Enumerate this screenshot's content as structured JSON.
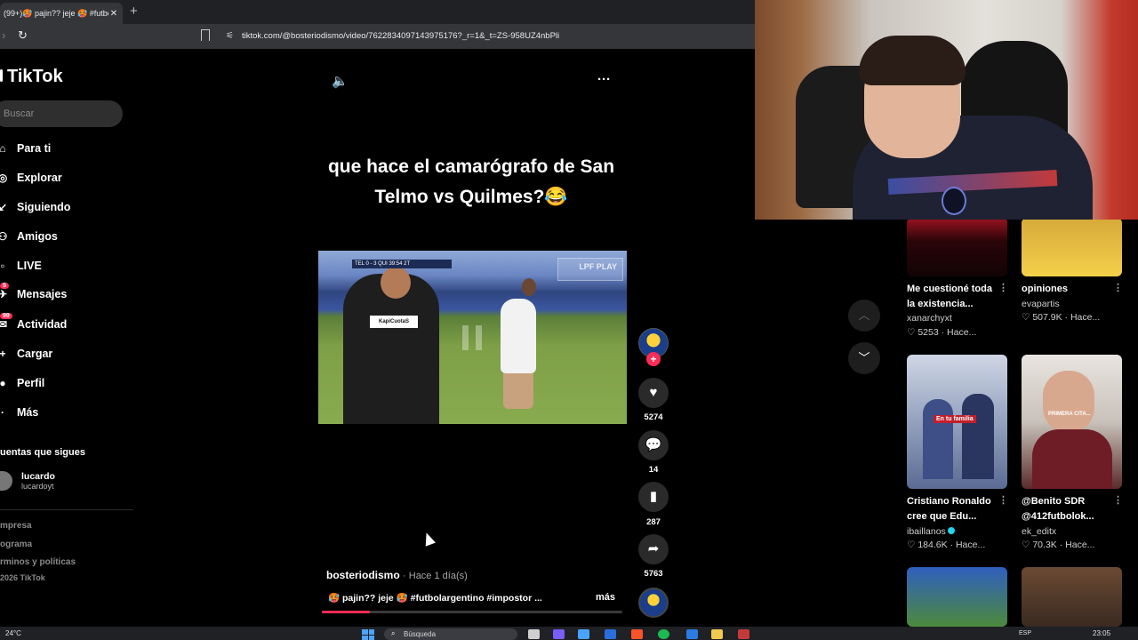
{
  "browser": {
    "tab_title": "(99+)🥵 pajin?? jeje 🥵 #futbo",
    "tab_close": "✕",
    "new_tab": "+",
    "url": "tiktok.com/@bosteriodismo/video/7622834097143975176?_r=1&_t=ZS-958UZ4nbPli",
    "icons": {
      "forward": "chevron-right-icon",
      "reload": "reload-icon",
      "bookmark": "bookmark-icon",
      "site_settings": "tune-icon"
    }
  },
  "sidebar": {
    "logo": "TikTok",
    "search_placeholder": "Buscar",
    "items": [
      {
        "label": "Para ti",
        "icon": "home-icon"
      },
      {
        "label": "Explorar",
        "icon": "compass-icon"
      },
      {
        "label": "Siguiendo",
        "icon": "following-icon"
      },
      {
        "label": "Amigos",
        "icon": "friends-icon"
      },
      {
        "label": "LIVE",
        "icon": "live-icon"
      },
      {
        "label": "Mensajes",
        "icon": "messages-icon",
        "badge": "5"
      },
      {
        "label": "Actividad",
        "icon": "activity-icon",
        "badge": "99"
      },
      {
        "label": "Cargar",
        "icon": "upload-icon"
      },
      {
        "label": "Perfil",
        "icon": "profile-icon"
      },
      {
        "label": "Más",
        "icon": "more-icon"
      }
    ],
    "following_title": "uentas que sigues",
    "followed_account": {
      "name": "lucardo",
      "handle": "lucardoyt"
    },
    "footer": [
      "mpresa",
      "ograma",
      "rminos y políticas",
      "2026 TikTok"
    ]
  },
  "video": {
    "caption": "que hace el camarógrafo de San Telmo vs Quilmes?😂",
    "scorebug": "TEL 0 - 3 QUI  39:54 2T",
    "watermark": "LPF PLAY",
    "sponsor": "KapiCuotaS",
    "author": "bosteriodismo",
    "time_ago": "· Hace 1 día(s)",
    "description": "🥵 pajin?? jeje 🥵 #futbolargentino #impostor ...",
    "more_label": "más",
    "progress": 0.16,
    "icons": {
      "sound": "volume-icon",
      "options": "more-dots-icon",
      "playback": "pause-icon"
    }
  },
  "actions": {
    "likes": "5274",
    "comments": "14",
    "saves": "287",
    "shares": "5763",
    "follow_plus": "+"
  },
  "recommendations": [
    {
      "title_line1": "Me cuestioné toda",
      "title_line2": "la existencia...",
      "author": "xanarchyxt",
      "likes": "5253",
      "time": "Hace..."
    },
    {
      "title_line1": "opiniones",
      "title_line2": "",
      "author": "evapartis",
      "likes": "507.9K",
      "time": "Hace..."
    },
    {
      "title_line1": "Cristiano Ronaldo",
      "title_line2": "cree que Edu...",
      "author": "ibaillanos",
      "likes": "184.6K",
      "time": "Hace...",
      "thumb_text": "En tu familia"
    },
    {
      "title_line1": "@Benito SDR",
      "title_line2": "@412futbolok...",
      "author": "ek_editx",
      "likes": "70.3K",
      "time": "Hace...",
      "thumb_text": "PRIMERA CITA..."
    }
  ],
  "taskbar": {
    "weather": "24°C",
    "search_label": "Búsqueda",
    "language": "ESP",
    "time": "23:05"
  }
}
